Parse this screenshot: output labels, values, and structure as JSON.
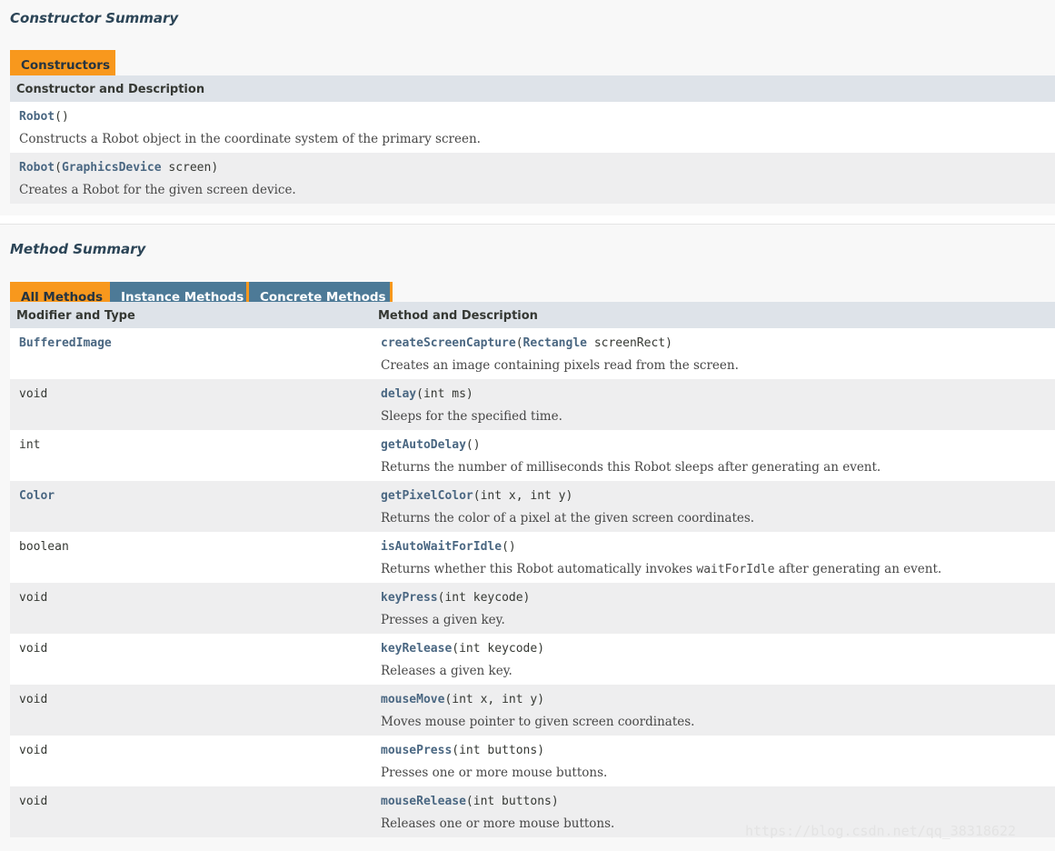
{
  "constructor_summary": {
    "title": "Constructor Summary",
    "tab_label": "Constructors",
    "header": "Constructor and Description",
    "rows": [
      {
        "name": "Robot",
        "params": [],
        "suffix": "()",
        "description": "Constructs a Robot object in the coordinate system of the primary screen."
      },
      {
        "name": "Robot",
        "paren_open": "(",
        "param_type": "GraphicsDevice",
        "param_rest": " screen)",
        "description": "Creates a Robot for the given screen device."
      }
    ]
  },
  "method_summary": {
    "title": "Method Summary",
    "tabs": [
      "All Methods",
      "Instance Methods",
      "Concrete Methods"
    ],
    "active_tab": "All Methods",
    "headers": {
      "col1": "Modifier and Type",
      "col2": "Method and Description"
    },
    "rows": [
      {
        "type": "BufferedImage",
        "type_link": true,
        "name": "createScreenCapture",
        "sig_pre": "(",
        "sig_link": "Rectangle",
        "sig_post": " screenRect)",
        "description": "Creates an image containing pixels read from the screen."
      },
      {
        "type": "void",
        "type_link": false,
        "name": "delay",
        "sig_pre": "(int ms)",
        "description": "Sleeps for the specified time."
      },
      {
        "type": "int",
        "type_link": false,
        "name": "getAutoDelay",
        "sig_pre": "()",
        "description": "Returns the number of milliseconds this Robot sleeps after generating an event."
      },
      {
        "type": "Color",
        "type_link": true,
        "name": "getPixelColor",
        "sig_pre": "(int x, int y)",
        "description": "Returns the color of a pixel at the given screen coordinates."
      },
      {
        "type": "boolean",
        "type_link": false,
        "name": "isAutoWaitForIdle",
        "sig_pre": "()",
        "description_pre": "Returns whether this Robot automatically invokes ",
        "description_code": "waitForIdle",
        "description_post": " after generating an event."
      },
      {
        "type": "void",
        "type_link": false,
        "name": "keyPress",
        "sig_pre": "(int keycode)",
        "description": "Presses a given key."
      },
      {
        "type": "void",
        "type_link": false,
        "name": "keyRelease",
        "sig_pre": "(int keycode)",
        "description": "Releases a given key."
      },
      {
        "type": "void",
        "type_link": false,
        "name": "mouseMove",
        "sig_pre": "(int x, int y)",
        "description": "Moves mouse pointer to given screen coordinates."
      },
      {
        "type": "void",
        "type_link": false,
        "name": "mousePress",
        "sig_pre": "(int buttons)",
        "description": "Presses one or more mouse buttons."
      },
      {
        "type": "void",
        "type_link": false,
        "name": "mouseRelease",
        "sig_pre": "(int buttons)",
        "description": "Releases one or more mouse buttons."
      }
    ]
  },
  "watermark": "https://blog.csdn.net/qq_38318622",
  "colors": {
    "active_tab": "#f8981d",
    "inactive_tab": "#4d7a97",
    "header_bg": "#dee3e9",
    "link": "#4a6782"
  }
}
